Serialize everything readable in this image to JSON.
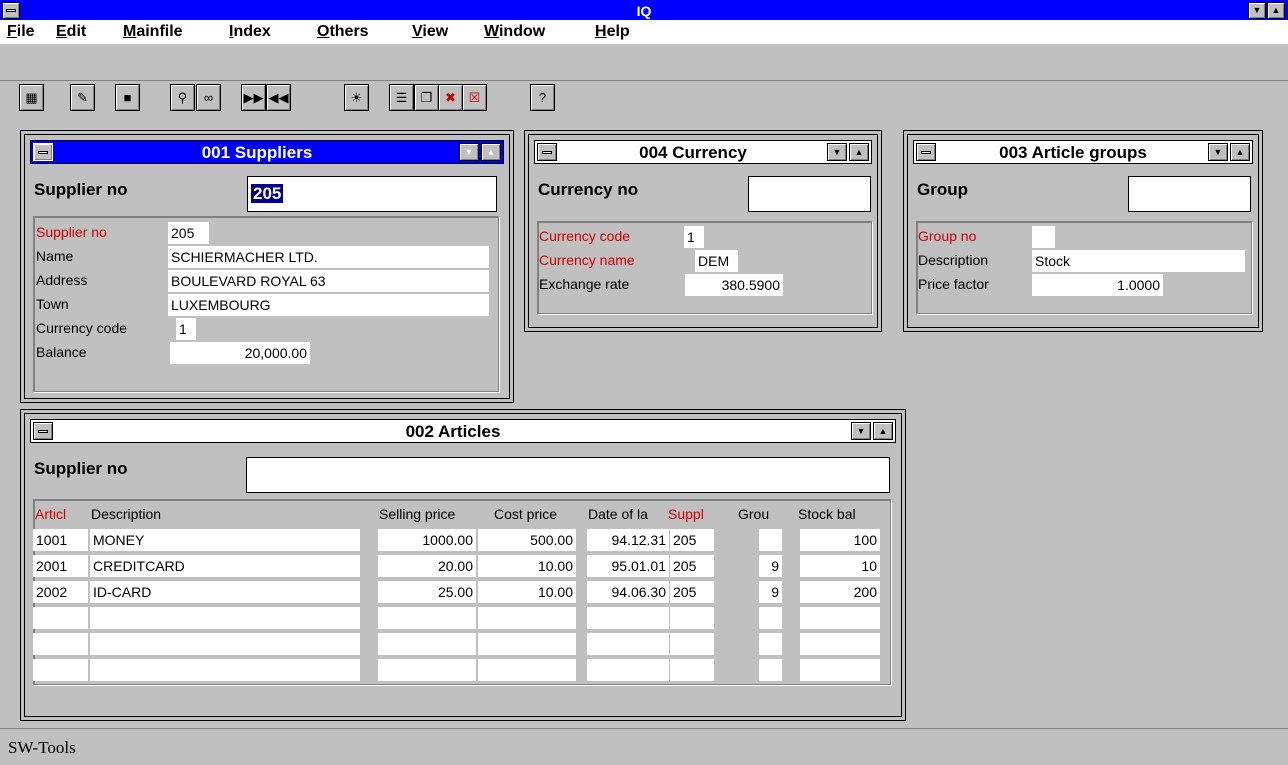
{
  "app": {
    "title": "IQ"
  },
  "menu": [
    {
      "u": "F",
      "rest": "ile"
    },
    {
      "u": "E",
      "rest": "dit"
    },
    {
      "u": "M",
      "rest": "ainfile"
    },
    {
      "u": "I",
      "rest": "ndex"
    },
    {
      "u": "O",
      "rest": "thers"
    },
    {
      "u": "V",
      "rest": "iew"
    },
    {
      "u": "W",
      "rest": "indow"
    },
    {
      "u": "H",
      "rest": "elp"
    }
  ],
  "toolbar": {
    "icons": [
      "calculator-icon",
      "edit-record-icon",
      "save-icon",
      "search-icon",
      "glasses-icon",
      "next-icon",
      "previous-icon",
      "lightbulb-icon",
      "layout-icon",
      "cascade-icon",
      "delete-record-icon",
      "close-record-icon",
      "help-icon"
    ]
  },
  "suppliers": {
    "title": "001  Suppliers",
    "key_label": "Supplier no",
    "key_value": "205",
    "fields": [
      {
        "label": "Supplier no",
        "value": "205"
      },
      {
        "label": "Name",
        "value": "SCHIERMACHER LTD."
      },
      {
        "label": "Address",
        "value": "BOULEVARD ROYAL 63"
      },
      {
        "label": "Town",
        "value": "LUXEMBOURG"
      },
      {
        "label": "Currency code",
        "value": "1"
      },
      {
        "label": "Balance",
        "value": "20,000.00"
      }
    ]
  },
  "currency": {
    "title": "004  Currency",
    "key_label": "Currency no",
    "key_value": "",
    "fields": [
      {
        "label": "Currency code",
        "value": "1"
      },
      {
        "label": "Currency name",
        "value": "DEM"
      },
      {
        "label": "Exchange rate",
        "value": "380.5900"
      }
    ]
  },
  "groups": {
    "title": "003  Article groups",
    "key_label": "Group",
    "key_value": "",
    "fields": [
      {
        "label": "Group no",
        "value": ""
      },
      {
        "label": "Description",
        "value": "Stock"
      },
      {
        "label": "Price factor",
        "value": "1.0000"
      }
    ]
  },
  "articles": {
    "title": "002  Articles",
    "key_label": "Supplier no",
    "key_value": "",
    "columns": [
      "Articl",
      "Description",
      "Selling price",
      "Cost price",
      "Date of la",
      "Suppl",
      "Grou",
      "Stock bal"
    ],
    "rows": [
      [
        "1001",
        "MONEY",
        "1000.00",
        "500.00",
        "94.12.31",
        "205",
        "",
        "100"
      ],
      [
        "2001",
        "CREDITCARD",
        "20.00",
        "10.00",
        "95.01.01",
        "205",
        "9",
        "10"
      ],
      [
        "2002",
        "ID-CARD",
        "25.00",
        "10.00",
        "94.06.30",
        "205",
        "9",
        "200"
      ],
      [
        "",
        "",
        "",
        "",
        "",
        "",
        "",
        ""
      ],
      [
        "",
        "",
        "",
        "",
        "",
        "",
        "",
        ""
      ],
      [
        "",
        "",
        "",
        "",
        "",
        "",
        "",
        ""
      ]
    ]
  },
  "status": {
    "text": "SW-Tools"
  }
}
